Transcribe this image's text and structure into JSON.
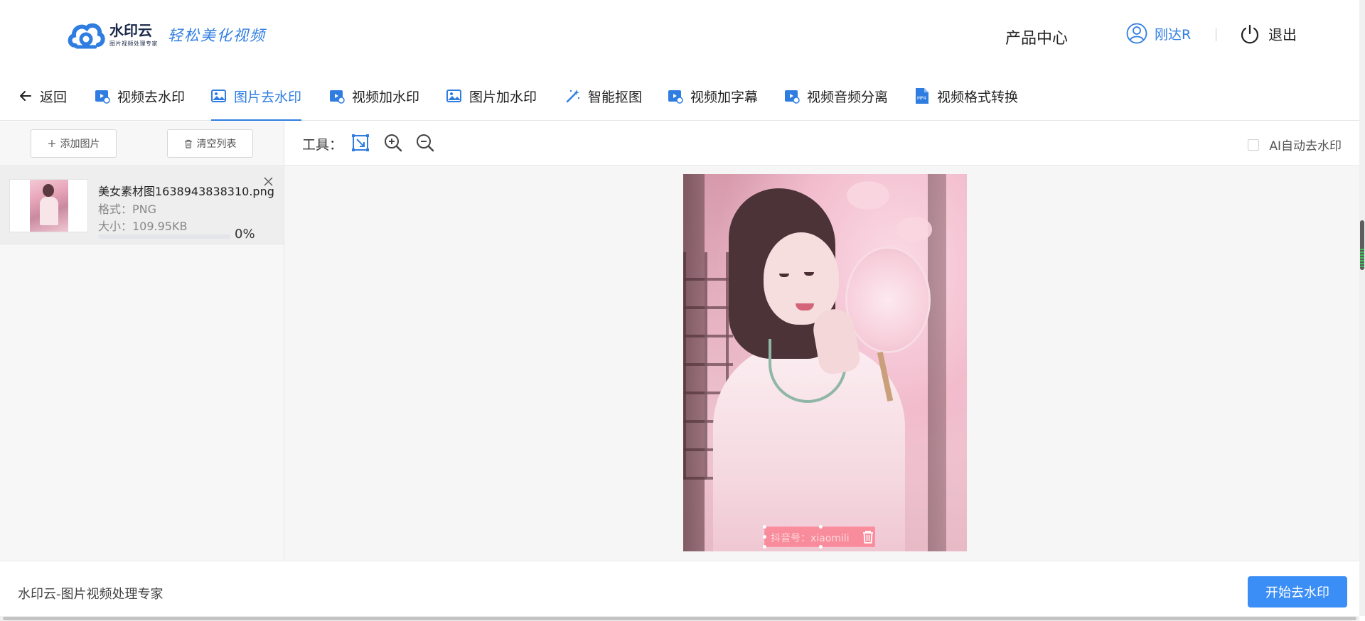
{
  "header": {
    "logo_name": "水印云",
    "logo_sub": "图片视频处理专家",
    "slogan": "轻松美化视频",
    "product_center": "产品中心",
    "user_name": "刚达R",
    "logout": "退出",
    "accent": "#2f7de1"
  },
  "nav": {
    "back": "返回",
    "tabs": [
      {
        "label": "视频去水印",
        "icon": "video-clip-icon"
      },
      {
        "label": "图片去水印",
        "icon": "image-icon",
        "active": true
      },
      {
        "label": "视频加水印",
        "icon": "video-clip-icon"
      },
      {
        "label": "图片加水印",
        "icon": "image-icon"
      },
      {
        "label": "智能抠图",
        "icon": "magic-wand-icon"
      },
      {
        "label": "视频加字幕",
        "icon": "video-clip-icon"
      },
      {
        "label": "视频音频分离",
        "icon": "video-clip-icon"
      },
      {
        "label": "视频格式转换",
        "icon": "mp4-file-icon"
      }
    ]
  },
  "left_panel": {
    "add_image": "添加图片",
    "clear_list": "清空列表",
    "files": [
      {
        "name": "美女素材图1638943838310.png",
        "format_label": "格式：PNG",
        "size_label": "大小：109.95KB",
        "progress": 0,
        "progress_label": "0%"
      }
    ]
  },
  "main": {
    "tools_label": "工具：",
    "ai_auto_label": "AI自动去水印",
    "ai_auto_checked": false,
    "watermark_text": "抖音号：xiaomili"
  },
  "footer": {
    "brand_text": "水印云-图片视频处理专家",
    "start_button": "开始去水印",
    "button_color": "#3b8ef5"
  }
}
